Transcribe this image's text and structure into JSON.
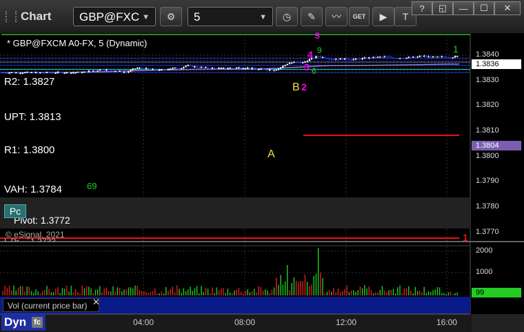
{
  "app": {
    "title": "Chart"
  },
  "toolbar": {
    "symbol": "GBP@FXC",
    "interval": "5"
  },
  "window": {
    "help": "?",
    "restore": "◱",
    "minimize": "—",
    "maximize": "☐",
    "close": "✕"
  },
  "header": {
    "description": "* GBP@FXCM A0-FX, 5 (Dynamic)"
  },
  "levels": [
    {
      "label": "R2: 1.3827",
      "price": 1.3827,
      "color": "#2233cc"
    },
    {
      "label": "UPT: 1.3813",
      "price": 1.3813,
      "color": "#6a6adf"
    },
    {
      "label": "R1: 1.3800",
      "price": 1.38,
      "color": "#2233cc"
    },
    {
      "label": "VAH: 1.3784",
      "price": 1.3784,
      "color": "#00dddd"
    },
    {
      "label": "Pivot: 1.3772",
      "price": 1.3772,
      "color": "#2233cc"
    }
  ],
  "annotations": {
    "a": "A",
    "b": "B",
    "n2": "2",
    "n3": "3",
    "n4": "4",
    "n5": "5",
    "g1": "1",
    "r1": "1",
    "g9": "9",
    "g69": "69",
    "g6": "6"
  },
  "labels": {
    "pc": "Pc",
    "copyright": "© eSignal, 2021",
    "overflow": "L Pr ... 1.3733"
  },
  "price_axis": {
    "ticks": [
      "1.3840",
      "1.3830",
      "1.3820",
      "1.3810",
      "1.3800",
      "1.3790",
      "1.3780",
      "1.3770"
    ],
    "last": "1.3836",
    "ma": "1.3804"
  },
  "volume": {
    "label": "Vol (current price bar)",
    "ticks": [
      "2000",
      "1000"
    ],
    "last": "99"
  },
  "time_axis": [
    "04:00",
    "08:00",
    "12:00",
    "16:00"
  ],
  "footer": {
    "dyn": "Dyn"
  },
  "colors": {
    "up": "#ffffff",
    "down": "#1a3dff",
    "green": "#22cc22",
    "magenta": "#ff00ff",
    "yellow": "#f0e040",
    "red": "#ee1111",
    "ma": "#9a7ad0"
  }
}
